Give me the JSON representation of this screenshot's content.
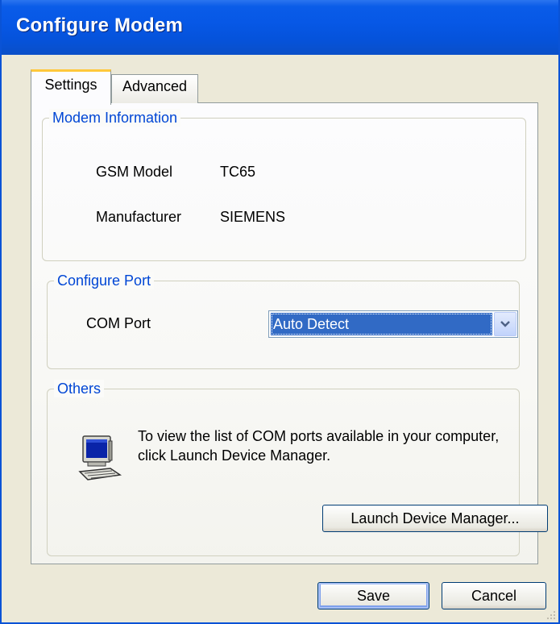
{
  "window": {
    "title": "Configure Modem"
  },
  "tabs": [
    {
      "label": "Settings",
      "active": true
    },
    {
      "label": "Advanced",
      "active": false
    }
  ],
  "modem_info": {
    "legend": "Modem Information",
    "gsm_model_label": "GSM Model",
    "gsm_model_value": "TC65",
    "manufacturer_label": "Manufacturer",
    "manufacturer_value": "SIEMENS"
  },
  "configure_port": {
    "legend": "Configure Port",
    "com_port_label": "COM Port",
    "com_port_value": "Auto Detect"
  },
  "others": {
    "legend": "Others",
    "info_line1": "To view the list of COM ports available in your computer,",
    "info_line2": "click Launch Device Manager.",
    "launch_button": "Launch Device Manager..."
  },
  "footer": {
    "save_label": "Save",
    "cancel_label": "Cancel"
  },
  "colors": {
    "titlebar": "#0553dc",
    "legend_text": "#0046d5",
    "selection": "#316ac5",
    "dialog_bg": "#ece9d8"
  },
  "icons": {
    "others": "computer-icon",
    "dropdown": "chevron-down-icon"
  }
}
